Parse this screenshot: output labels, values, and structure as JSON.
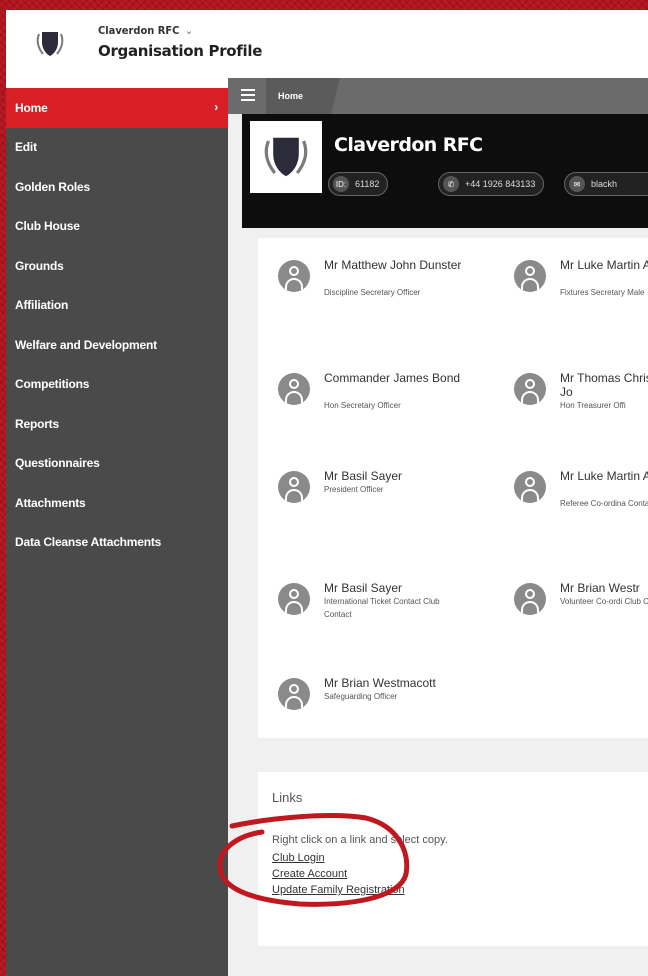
{
  "header": {
    "org_name": "Claverdon RFC",
    "org_chevron": "⌄",
    "page_title": "Organisation Profile"
  },
  "sidebar": {
    "items": [
      {
        "label": "Home",
        "active": true
      },
      {
        "label": "Edit"
      },
      {
        "label": "Golden Roles"
      },
      {
        "label": "Club House"
      },
      {
        "label": "Grounds"
      },
      {
        "label": "Affiliation"
      },
      {
        "label": "Welfare and Development"
      },
      {
        "label": "Competitions"
      },
      {
        "label": "Reports"
      },
      {
        "label": "Questionnaires"
      },
      {
        "label": "Attachments"
      },
      {
        "label": "Data Cleanse Attachments"
      }
    ],
    "active_arrow": "›"
  },
  "breadcrumb": {
    "current": "Home"
  },
  "club": {
    "title": "Claverdon RFC",
    "id_label": "ID:",
    "id_value": "61182",
    "phone": "+44 1926 843133",
    "email": "blackh"
  },
  "officers": [
    {
      "name": "Mr Matthew John Dunster",
      "role": "Discipline Secretary Officer"
    },
    {
      "name": "Mr Luke Martin Allsopp",
      "role": "Fixtures Secretary Male"
    },
    {
      "name": "Commander James Bond",
      "role": "Hon Secretary Officer"
    },
    {
      "name": "Mr Thomas Christopher Jo",
      "role": "Hon Treasurer Offi"
    },
    {
      "name": "Mr Basil Sayer",
      "role": "President Officer"
    },
    {
      "name": "Mr Luke Martin Allsopp",
      "role": "Referee Co-ordina Contact"
    },
    {
      "name": "Mr Basil Sayer",
      "role": "International Ticket Contact Club Contact"
    },
    {
      "name": "Mr Brian Westr",
      "role": "Volunteer Co-ordi Club Contact"
    },
    {
      "name": "Mr Brian Westmacott",
      "role": "Safeguarding Officer"
    }
  ],
  "links": {
    "title": "Links",
    "hint": "Right click on a link and select copy.",
    "items": [
      "Club Login",
      "Create Account",
      "Update Family Registration"
    ]
  },
  "colors": {
    "accent_red": "#d91f26",
    "sidebar_bg": "#4a4a4a",
    "annotation_red": "#c0181f"
  }
}
